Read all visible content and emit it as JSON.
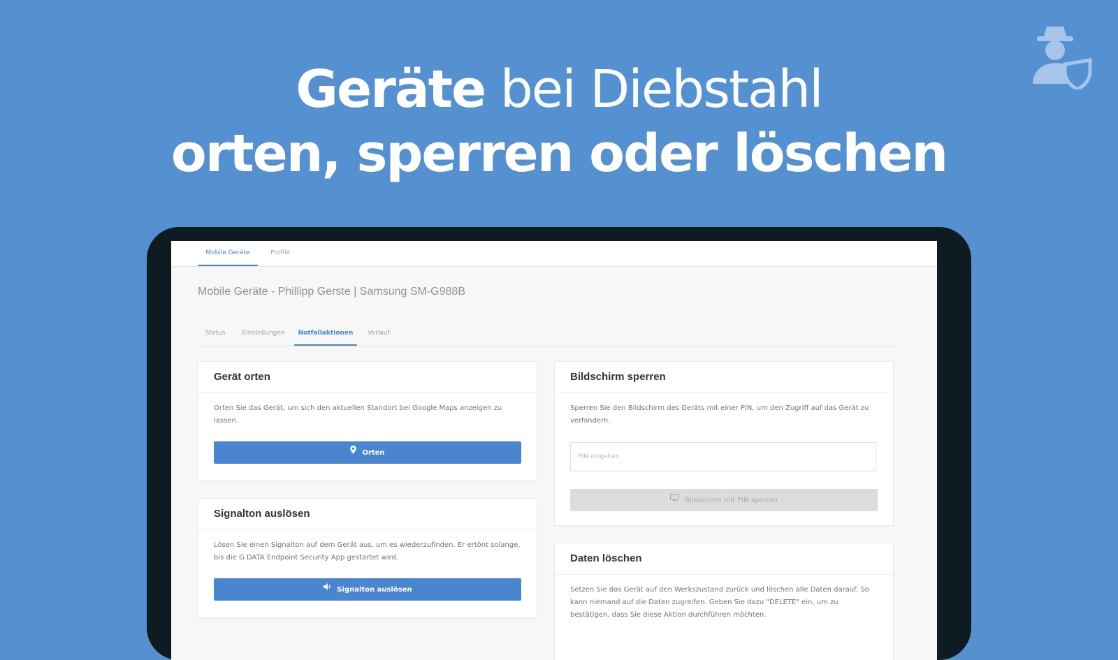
{
  "headline": {
    "line1_bold": "Geräte",
    "line1_light": " bei Diebstahl",
    "line2": "orten, sperren oder löschen"
  },
  "brand": {
    "logo_icon": "spy-shield-icon"
  },
  "top_tabs": [
    {
      "label": "Mobile Geräte",
      "active": true
    },
    {
      "label": "Profile",
      "active": false
    }
  ],
  "page_title": "Mobile Geräte - Phillipp Gerste | Samsung SM-G988B",
  "sub_tabs": [
    {
      "label": "Status",
      "active": false
    },
    {
      "label": "Einstellungen",
      "active": false
    },
    {
      "label": "Notfallaktionen",
      "active": true
    },
    {
      "label": "Verlauf",
      "active": false
    }
  ],
  "cards": {
    "locate": {
      "title": "Gerät orten",
      "text": "Orten Sie das Gerät, um sich den aktuellen Standort bei Google Maps anzeigen zu lassen.",
      "button_label": "Orten",
      "button_icon": "map-pin-icon"
    },
    "ring": {
      "title": "Signalton auslösen",
      "text": "Lösen Sie einen Signalton auf dem Gerät aus, um es wiederzufinden. Er ertönt solange, bis die G DATA Endpoint Security App gestartet wird.",
      "button_label": "Signalton auslösen",
      "button_icon": "speaker-icon"
    },
    "lock": {
      "title": "Bildschirm sperren",
      "text": "Sperren Sie den Bildschirm des Geräts mit einer PIN, um den Zugriff auf das Gerät zu verhindern.",
      "pin_placeholder": "PIN eingeben",
      "button_label": "Bildschirm mit PIN sperren",
      "button_icon": "lock-screen-icon"
    },
    "wipe": {
      "title": "Daten löschen",
      "text": "Setzen Sie das Gerät auf den Werkszustand zurück und löschen alle Daten darauf. So kann niemand auf die Daten zugreifen. Geben Sie dazu \"DELETE\" ein, um zu bestätigen, dass Sie diese Aktion durchführen möchten."
    }
  },
  "colors": {
    "background": "#5590d1",
    "accent": "#4a85cf",
    "bezel": "#0e1c22"
  }
}
